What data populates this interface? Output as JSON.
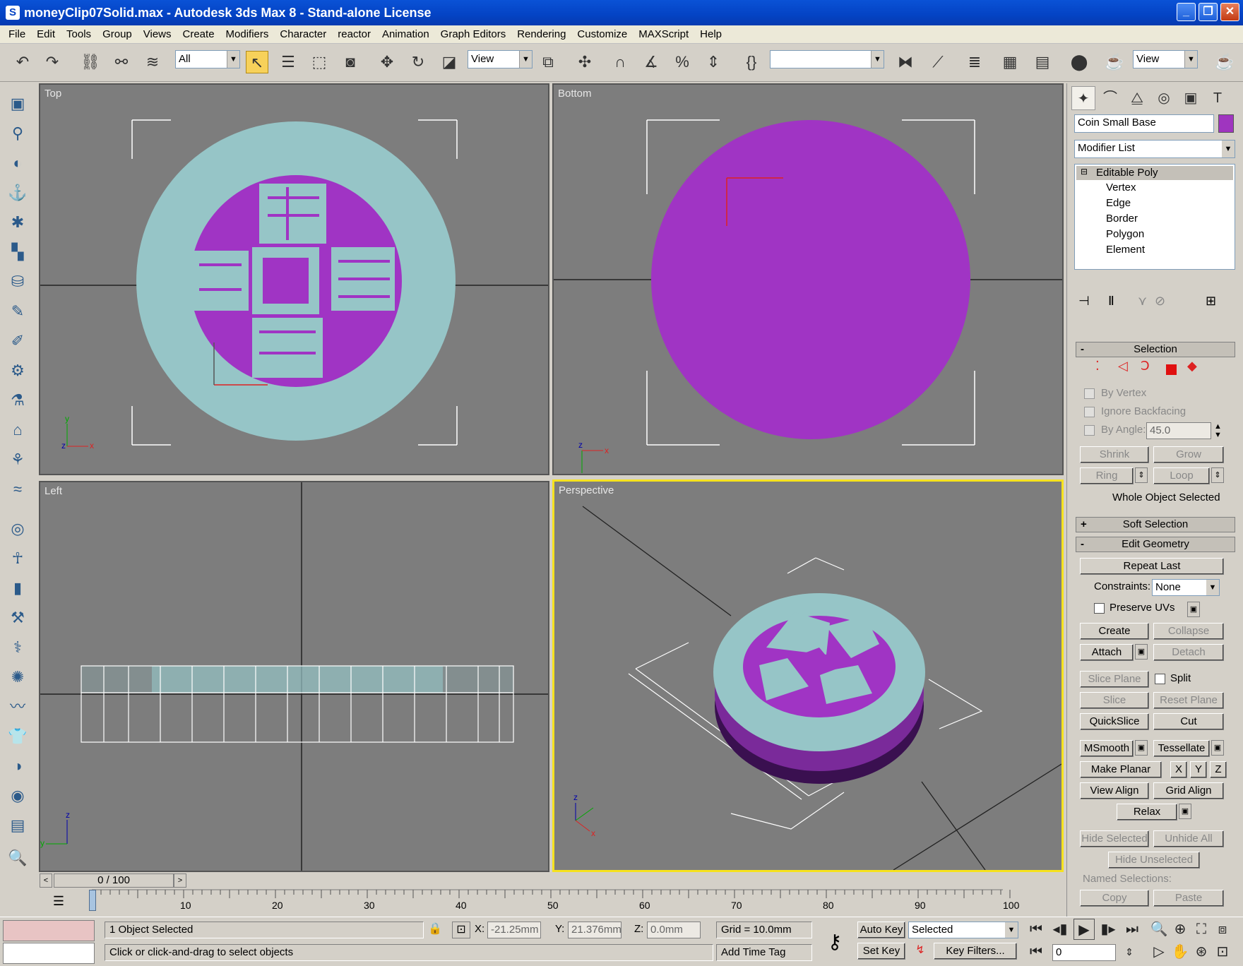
{
  "window": {
    "title": "moneyClip07Solid.max - Autodesk 3ds Max 8  - Stand-alone License",
    "icon": "S"
  },
  "menu": [
    "File",
    "Edit",
    "Tools",
    "Group",
    "Views",
    "Create",
    "Modifiers",
    "Character",
    "reactor",
    "Animation",
    "Graph Editors",
    "Rendering",
    "Customize",
    "MAXScript",
    "Help"
  ],
  "toolbar": {
    "selection_filter": "All",
    "ref_coord": "View",
    "named_selection": "",
    "view_combo": "View"
  },
  "viewports": {
    "top": "Top",
    "bottom": "Bottom",
    "left": "Left",
    "perspective": "Perspective"
  },
  "command_panel": {
    "object_name": "Coin Small Base",
    "object_color": "#9f35bf",
    "modifier_list": "Modifier List",
    "stack": [
      "Editable Poly",
      "Vertex",
      "Edge",
      "Border",
      "Polygon",
      "Element"
    ],
    "selection": {
      "title": "Selection",
      "by_vertex": "By Vertex",
      "ignore_backfacing": "Ignore Backfacing",
      "by_angle": "By Angle:",
      "angle_value": "45.0",
      "shrink": "Shrink",
      "grow": "Grow",
      "ring": "Ring",
      "loop": "Loop",
      "status": "Whole Object Selected"
    },
    "soft_selection": "Soft Selection",
    "edit_geometry": {
      "title": "Edit Geometry",
      "repeat_last": "Repeat Last",
      "constraints_label": "Constraints:",
      "constraints_value": "None",
      "preserve_uvs": "Preserve UVs",
      "create": "Create",
      "collapse": "Collapse",
      "attach": "Attach",
      "detach": "Detach",
      "slice_plane": "Slice Plane",
      "split": "Split",
      "slice": "Slice",
      "reset_plane": "Reset Plane",
      "quickslice": "QuickSlice",
      "cut": "Cut",
      "msmooth": "MSmooth",
      "tessellate": "Tessellate",
      "make_planar": "Make Planar",
      "x": "X",
      "y": "Y",
      "z": "Z",
      "view_align": "View Align",
      "grid_align": "Grid Align",
      "relax": "Relax",
      "hide_selected": "Hide Selected",
      "unhide_all": "Unhide All",
      "hide_unselected": "Hide Unselected",
      "named_selections": "Named Selections:",
      "copy": "Copy",
      "paste": "Paste"
    }
  },
  "timeline": {
    "frame_display": "0 / 100",
    "ticks": [
      "10",
      "20",
      "30",
      "40",
      "50",
      "60",
      "70",
      "80",
      "90",
      "100"
    ]
  },
  "status": {
    "selection": "1 Object Selected",
    "prompt": "Click or click-and-drag to select objects",
    "x_label": "X:",
    "x": "-21.25mm",
    "y_label": "Y:",
    "y": "21.376mm",
    "z_label": "Z:",
    "z": "0.0mm",
    "grid": "Grid = 10.0mm",
    "add_time_tag": "Add Time Tag",
    "auto_key": "Auto Key",
    "set_key": "Set Key",
    "key_mode": "Selected",
    "key_filters": "Key Filters...",
    "current_frame": "0"
  },
  "colors": {
    "coin_rim": "#96c5c7",
    "coin_face": "#a034c4",
    "viewport_bg": "#7d7d7d",
    "active_border": "#f6e21e"
  }
}
